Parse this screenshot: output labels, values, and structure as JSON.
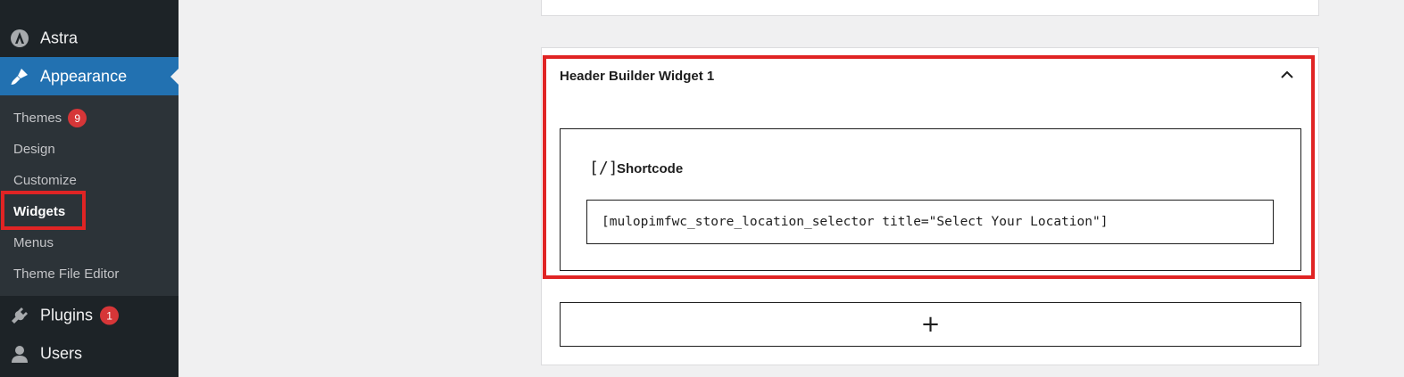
{
  "sidebar": {
    "astra": {
      "label": "Astra",
      "icon": "astra-logo-icon"
    },
    "appearance": {
      "label": "Appearance",
      "icon": "paintbrush-icon"
    },
    "submenu": [
      {
        "label": "Themes",
        "badge": "9"
      },
      {
        "label": "Design"
      },
      {
        "label": "Customize"
      },
      {
        "label": "Widgets",
        "current": true
      },
      {
        "label": "Menus"
      },
      {
        "label": "Theme File Editor"
      }
    ],
    "plugins": {
      "label": "Plugins",
      "badge": "1",
      "icon": "plugin-icon"
    },
    "users": {
      "label": "Users",
      "icon": "user-icon"
    }
  },
  "widget_area": {
    "title": "Header Builder Widget 1",
    "shortcode_block": {
      "icon_text": "[/]",
      "label": "Shortcode",
      "value": "[mulopimfwc_store_location_selector title=\"Select Your Location\"]"
    },
    "add_block_label": "+"
  },
  "colors": {
    "sidebar_bg": "#1d2327",
    "submenu_bg": "#2c3338",
    "accent": "#2271b1",
    "badge": "#d63638",
    "highlight": "#e02424"
  }
}
